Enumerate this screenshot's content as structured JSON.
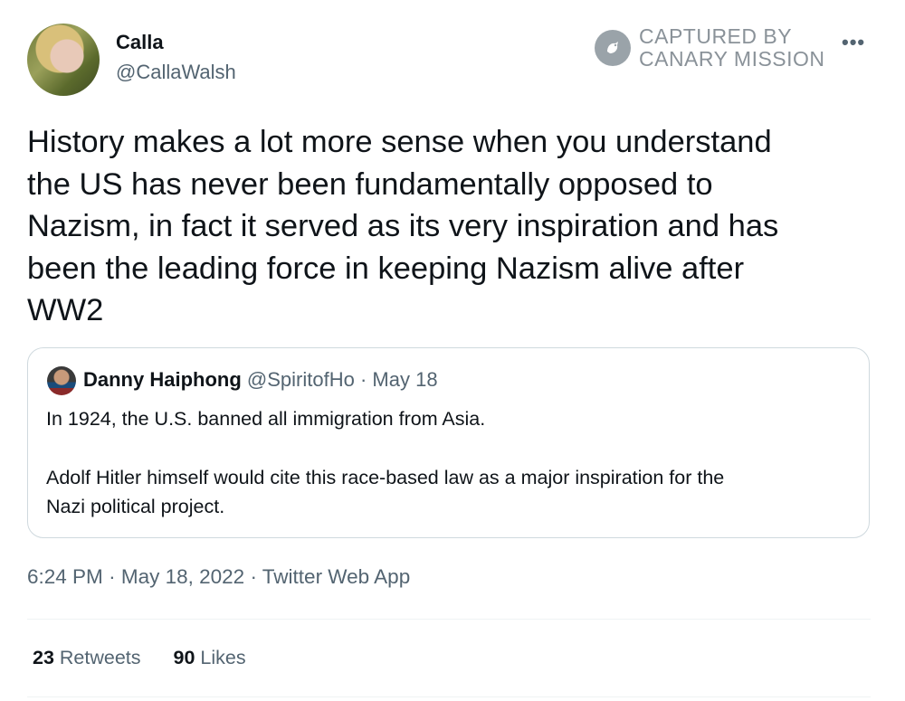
{
  "author": {
    "display_name": "Calla",
    "handle": "@CallaWalsh"
  },
  "watermark": {
    "line1": "CAPTURED BY",
    "line2": "CANARY MISSION"
  },
  "more_menu_icon": "more-icon",
  "tweet": {
    "lines": [
      "History makes a lot more sense when you understand",
      "the US has never been fundamentally opposed to",
      "Nazism, in fact it served as its very inspiration and has",
      "been the leading force in keeping Nazism alive after",
      "WW2"
    ]
  },
  "quote": {
    "display_name": "Danny Haiphong",
    "handle": "@SpiritofHo",
    "separator": "·",
    "date": "May 18",
    "paragraph1": "In 1924, the U.S. banned all immigration from Asia.",
    "paragraph2_line1": "Adolf Hitler himself would cite this race-based law as a major inspiration for the",
    "paragraph2_line2": "Nazi political project."
  },
  "meta": {
    "time": "6:24 PM",
    "separator": "·",
    "date": "May 18, 2022",
    "source": "Twitter Web App"
  },
  "stats": {
    "retweets_count": "23",
    "retweets_label": "Retweets",
    "likes_count": "90",
    "likes_label": "Likes"
  },
  "colors": {
    "text": "#0f1419",
    "secondary": "#536471",
    "border": "#cfd9de",
    "watermark": "#8a9299"
  }
}
